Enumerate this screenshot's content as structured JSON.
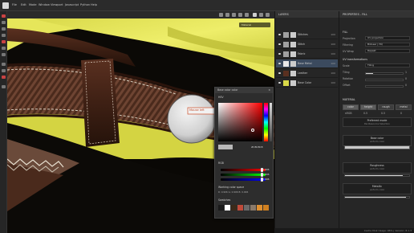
{
  "menu": [
    "File",
    "Edit",
    "Mode",
    "Window",
    "Viewport",
    "Javascript",
    "Python",
    "Help"
  ],
  "viewport": {
    "tag_button": "Material"
  },
  "annotation": {
    "text": "Mouse left"
  },
  "color_picker": {
    "title": "Base color color",
    "section_hsv": "HSV",
    "hex": "#C8C8C8",
    "section_rgb": "RGB",
    "r": "0.906",
    "g": "0.906",
    "b": "0.906",
    "working_label": "Working color space",
    "working_values": "R: 0.906   G: 0.906   B: 0.906",
    "swatches_label": "Swatches",
    "swatch_colors": [
      "#1a1a1a",
      "#ffffff",
      "#3a2a1a",
      "#c04a3a",
      "#6a6a6a",
      "#8a7a6a",
      "#e09030",
      "#d08020"
    ]
  },
  "layers": {
    "title": "LAYERS",
    "items": [
      {
        "name": "Stitches",
        "num": "100"
      },
      {
        "name": "Stitch",
        "num": "100"
      },
      {
        "name": "Fabric",
        "num": "100"
      },
      {
        "name": "Base Metal",
        "num": "100"
      },
      {
        "name": "Leather",
        "num": "100"
      },
      {
        "name": "Base Color",
        "num": "100"
      }
    ]
  },
  "properties": {
    "title": "PROPERTIES - FILL",
    "fill_label": "FILL",
    "projection_label": "Projection",
    "projection_value": "UV projection",
    "filtering_label": "Filtering",
    "filtering_value": "Bilinear | HQ",
    "uv_wrap_label": "UV Wrap",
    "uv_wrap_value": "Repeat",
    "uv_transform_label": "UV transformations",
    "scale_label": "Scale",
    "scale_value": "Tiling",
    "tiling_label": "Tiling",
    "tiling_value": "1",
    "rotation_label": "Rotation",
    "rotation_value": "0",
    "offset_label": "Offset",
    "offset_value": "0",
    "material_label": "MATERIAL",
    "channels": [
      "color",
      "height",
      "rough",
      "metal"
    ],
    "channel_values": [
      "sRGB",
      "0.5",
      "0.5",
      "0"
    ],
    "preferred_mode": "Preferred mode",
    "preferred_sub": "Per-Resource Selection",
    "base_color_label": "Base color",
    "base_color_sub": "uniform color",
    "roughness_label": "Roughness",
    "roughness_sub": "uniform color",
    "roughness_value": 0.9,
    "metallic_label": "Metallic",
    "metallic_sub": "uniform color",
    "metallic_value": 0.95
  },
  "status": {
    "text": "Cache Disk Usage:  96%  |  Version: 8.1.3"
  }
}
